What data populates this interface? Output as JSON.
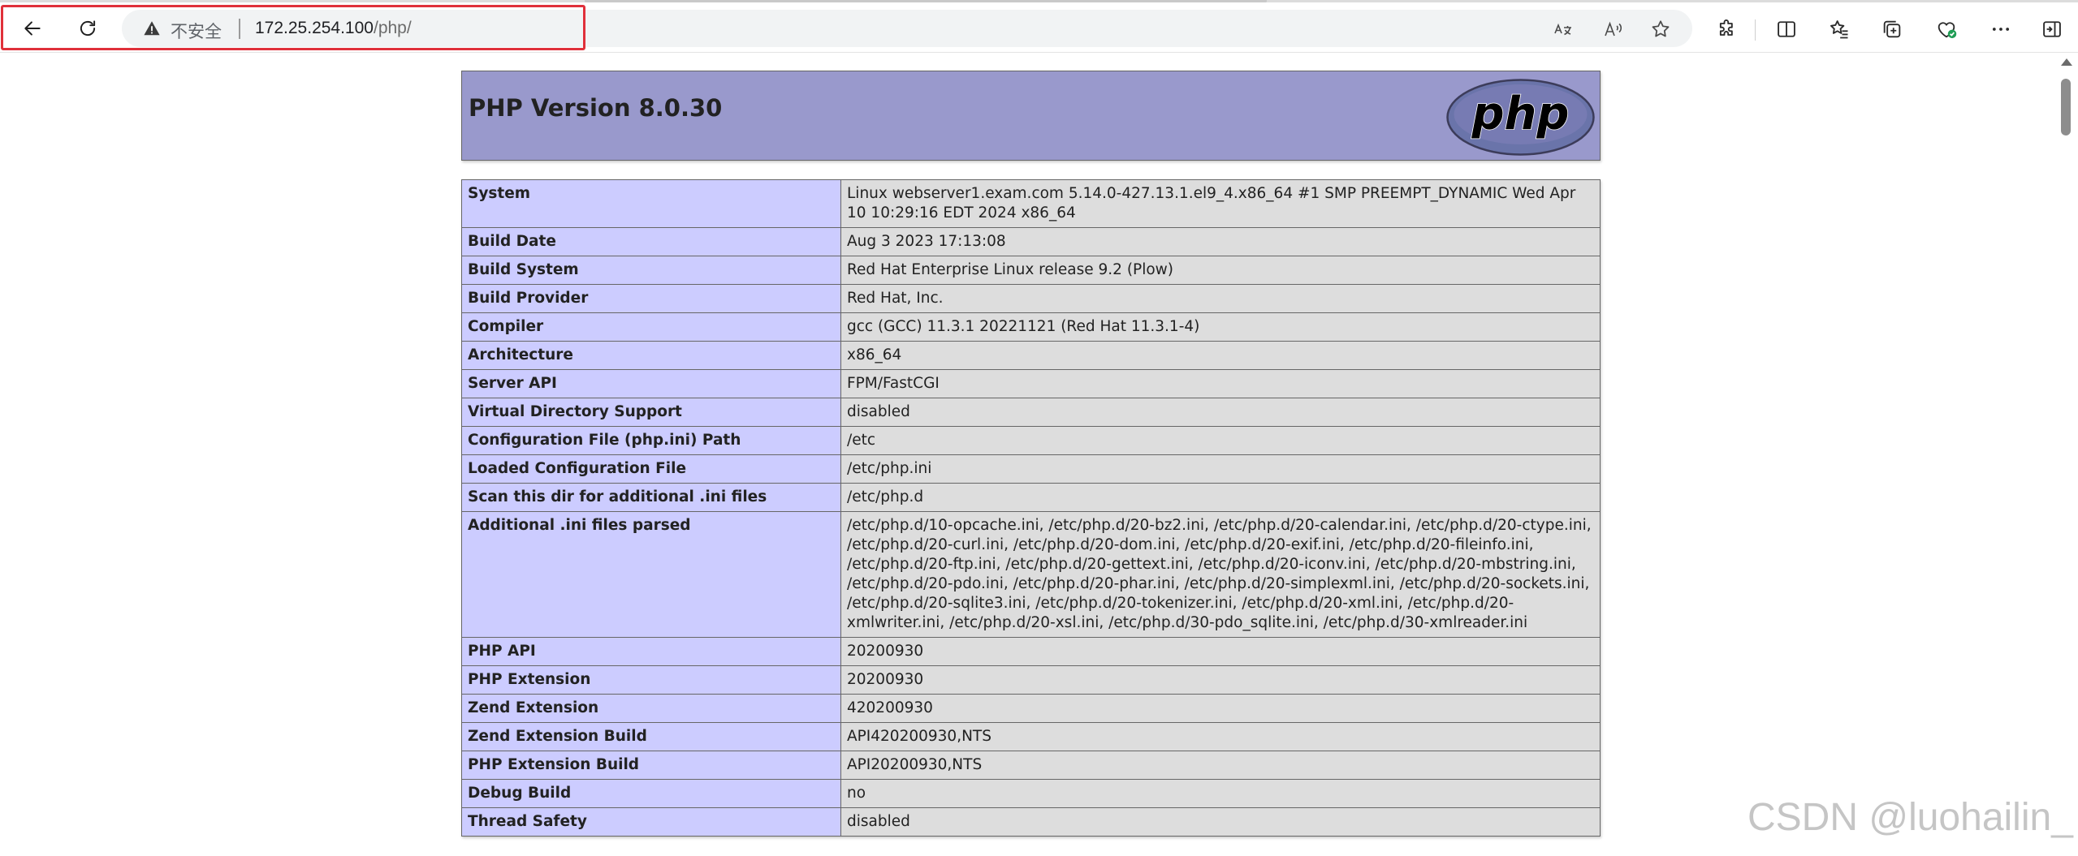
{
  "browser": {
    "security_label": "不安全",
    "url_host": "172.25.254.100",
    "url_path": "/php/",
    "icons": [
      "back-icon",
      "refresh-icon",
      "warning-icon",
      "translate-icon",
      "read-aloud-icon",
      "favorite-star-icon",
      "extensions-icon",
      "split-screen-icon",
      "favorites-icon",
      "collections-icon",
      "browser-essentials-icon",
      "more-icon",
      "sidebar-icon"
    ],
    "highlight_color": "#e0303a"
  },
  "php": {
    "title": "PHP Version 8.0.30",
    "header_bg": "#9999cc",
    "key_bg": "#ccccff",
    "value_bg": "#dddddd",
    "rows": [
      {
        "key": "System",
        "value": "Linux webserver1.exam.com 5.14.0-427.13.1.el9_4.x86_64 #1 SMP PREEMPT_DYNAMIC Wed Apr 10 10:29:16 EDT 2024 x86_64"
      },
      {
        "key": "Build Date",
        "value": "Aug 3 2023 17:13:08"
      },
      {
        "key": "Build System",
        "value": "Red Hat Enterprise Linux release 9.2 (Plow)"
      },
      {
        "key": "Build Provider",
        "value": "Red Hat, Inc."
      },
      {
        "key": "Compiler",
        "value": "gcc (GCC) 11.3.1 20221121 (Red Hat 11.3.1-4)"
      },
      {
        "key": "Architecture",
        "value": "x86_64"
      },
      {
        "key": "Server API",
        "value": "FPM/FastCGI"
      },
      {
        "key": "Virtual Directory Support",
        "value": "disabled"
      },
      {
        "key": "Configuration File (php.ini) Path",
        "value": "/etc"
      },
      {
        "key": "Loaded Configuration File",
        "value": "/etc/php.ini"
      },
      {
        "key": "Scan this dir for additional .ini files",
        "value": "/etc/php.d"
      },
      {
        "key": "Additional .ini files parsed",
        "value": "/etc/php.d/10-opcache.ini, /etc/php.d/20-bz2.ini, /etc/php.d/20-calendar.ini, /etc/php.d/20-ctype.ini, /etc/php.d/20-curl.ini, /etc/php.d/20-dom.ini, /etc/php.d/20-exif.ini, /etc/php.d/20-fileinfo.ini, /etc/php.d/20-ftp.ini, /etc/php.d/20-gettext.ini, /etc/php.d/20-iconv.ini, /etc/php.d/20-mbstring.ini, /etc/php.d/20-pdo.ini, /etc/php.d/20-phar.ini, /etc/php.d/20-simplexml.ini, /etc/php.d/20-sockets.ini, /etc/php.d/20-sqlite3.ini, /etc/php.d/20-tokenizer.ini, /etc/php.d/20-xml.ini, /etc/php.d/20-xmlwriter.ini, /etc/php.d/20-xsl.ini, /etc/php.d/30-pdo_sqlite.ini, /etc/php.d/30-xmlreader.ini"
      },
      {
        "key": "PHP API",
        "value": "20200930"
      },
      {
        "key": "PHP Extension",
        "value": "20200930"
      },
      {
        "key": "Zend Extension",
        "value": "420200930"
      },
      {
        "key": "Zend Extension Build",
        "value": "API420200930,NTS"
      },
      {
        "key": "PHP Extension Build",
        "value": "API20200930,NTS"
      },
      {
        "key": "Debug Build",
        "value": "no"
      },
      {
        "key": "Thread Safety",
        "value": "disabled"
      }
    ]
  },
  "watermark": "CSDN @luohailin_"
}
